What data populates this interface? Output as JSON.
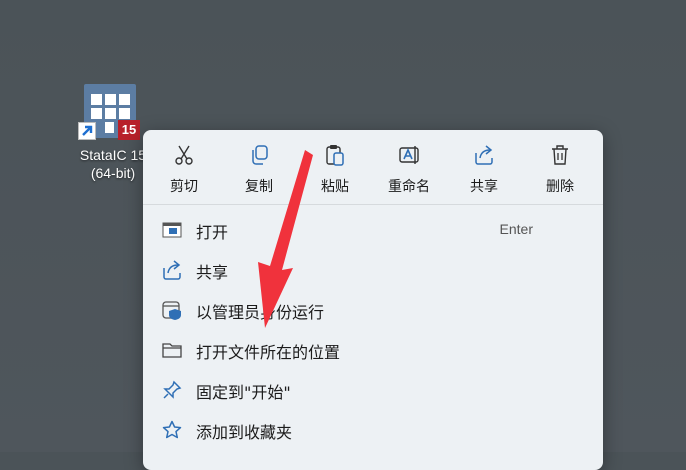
{
  "desktop_icon": {
    "label_line1": "StataIC 15",
    "label_line2": "(64-bit)",
    "badge": "15",
    "icon": "stata-app-icon"
  },
  "context_menu": {
    "actions": [
      {
        "label": "剪切",
        "icon": "scissors-icon"
      },
      {
        "label": "复制",
        "icon": "copy-icon"
      },
      {
        "label": "粘贴",
        "icon": "paste-icon"
      },
      {
        "label": "重命名",
        "icon": "rename-icon"
      },
      {
        "label": "共享",
        "icon": "share-icon"
      },
      {
        "label": "删除",
        "icon": "trash-icon"
      }
    ],
    "items": [
      {
        "label": "打开",
        "shortcut": "Enter",
        "icon": "open-window-icon"
      },
      {
        "label": "共享",
        "icon": "share-icon"
      },
      {
        "label": "以管理员身份运行",
        "icon": "admin-shield-icon"
      },
      {
        "label": "打开文件所在的位置",
        "icon": "folder-icon"
      },
      {
        "label": "固定到\"开始\"",
        "icon": "pin-icon"
      },
      {
        "label": "添加到收藏夹",
        "icon": "star-icon"
      }
    ]
  },
  "colors": {
    "desktop": "#4e555b",
    "menu_bg": "#edf1f4",
    "icon_accent": "#2f6fb5",
    "arrow": "#f0323c"
  }
}
